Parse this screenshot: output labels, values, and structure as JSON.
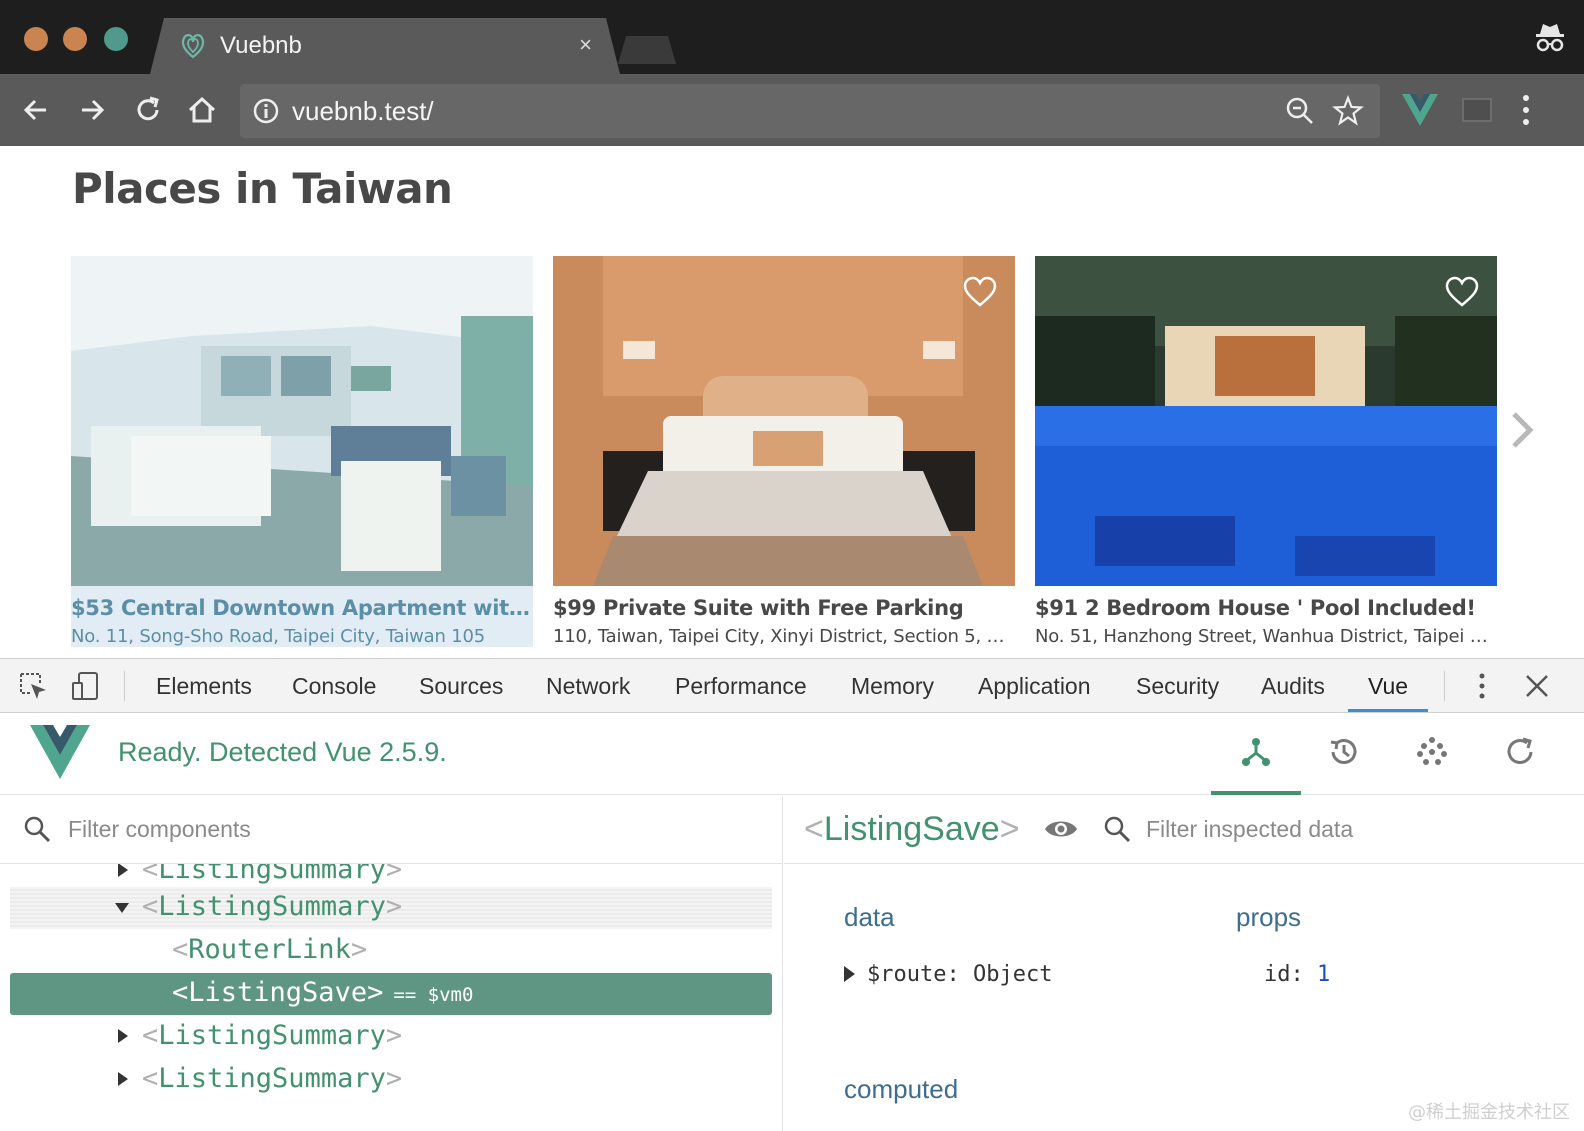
{
  "browser": {
    "tab_title": "Vuebnb",
    "tab_close": "×",
    "url": "vuebnb.test/"
  },
  "page": {
    "heading": "Places in Taiwan",
    "listings": [
      {
        "title": "$53 Central Downtown Apartment with A...",
        "address": "No. 11, Song-Sho Road, Taipei City, Taiwan 105",
        "highlighted": true
      },
      {
        "title": "$99 Private Suite with Free Parking",
        "address": "110, Taiwan, Taipei City, Xinyi District, Section 5, Xi...",
        "highlighted": false
      },
      {
        "title": "$91 2 Bedroom House ' Pool Included!",
        "address": "No. 51, Hanzhong Street, Wanhua District, Taipei C...",
        "highlighted": false
      }
    ]
  },
  "devtools": {
    "tabs": [
      "Elements",
      "Console",
      "Sources",
      "Network",
      "Performance",
      "Memory",
      "Application",
      "Security",
      "Audits",
      "Vue"
    ],
    "active_tab": "Vue",
    "vue": {
      "status": "Ready. Detected Vue 2.5.9.",
      "filter_placeholder": "Filter components",
      "tree": [
        {
          "name": "ListingSummary",
          "expanded": false,
          "depth": 1
        },
        {
          "name": "ListingSummary",
          "expanded": true,
          "depth": 1
        },
        {
          "name": "RouterLink",
          "depth": 2
        },
        {
          "name": "ListingSave",
          "depth": 2,
          "selected": true,
          "suffix": "== $vm0"
        },
        {
          "name": "ListingSummary",
          "expanded": false,
          "depth": 1
        },
        {
          "name": "ListingSummary",
          "expanded": false,
          "depth": 1
        }
      ],
      "inspected_component": "ListingSave",
      "inspect_filter_placeholder": "Filter inspected data",
      "data_title": "data",
      "data_route_key": "$route:",
      "data_route_value": "Object",
      "props_title": "props",
      "props_id_key": "id:",
      "props_id_value": "1",
      "computed_title": "computed"
    }
  },
  "watermark": "@稀土掘金技术社区",
  "colors": {
    "vue_green": "#42916f",
    "selected_row": "#5f9683",
    "active_tab_underline": "#3d8fd1"
  }
}
